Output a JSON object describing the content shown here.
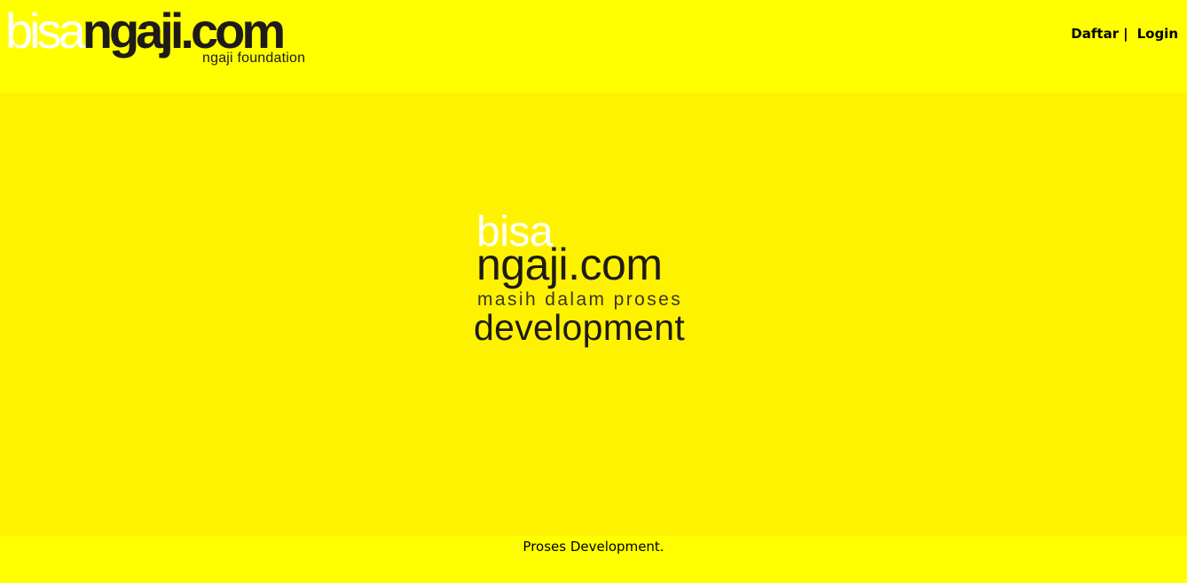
{
  "header": {
    "logo": {
      "part_light": "bisa",
      "part_dark": "ngaji.com",
      "tagline": "ngaji foundation"
    },
    "nav": {
      "daftar_label": "Daftar",
      "separator": "|",
      "login_label": "Login"
    }
  },
  "hero": {
    "word_light": "bisa",
    "word_dark": "ngaji.com",
    "subtitle": "masih dalam proses",
    "word_dev": "development"
  },
  "footer": {
    "text": "Proses Development."
  },
  "colors": {
    "background": "#ffff00",
    "hero_background": "#fff200",
    "logo_dark": "#1e1b18",
    "logo_light": "#ffffff"
  }
}
